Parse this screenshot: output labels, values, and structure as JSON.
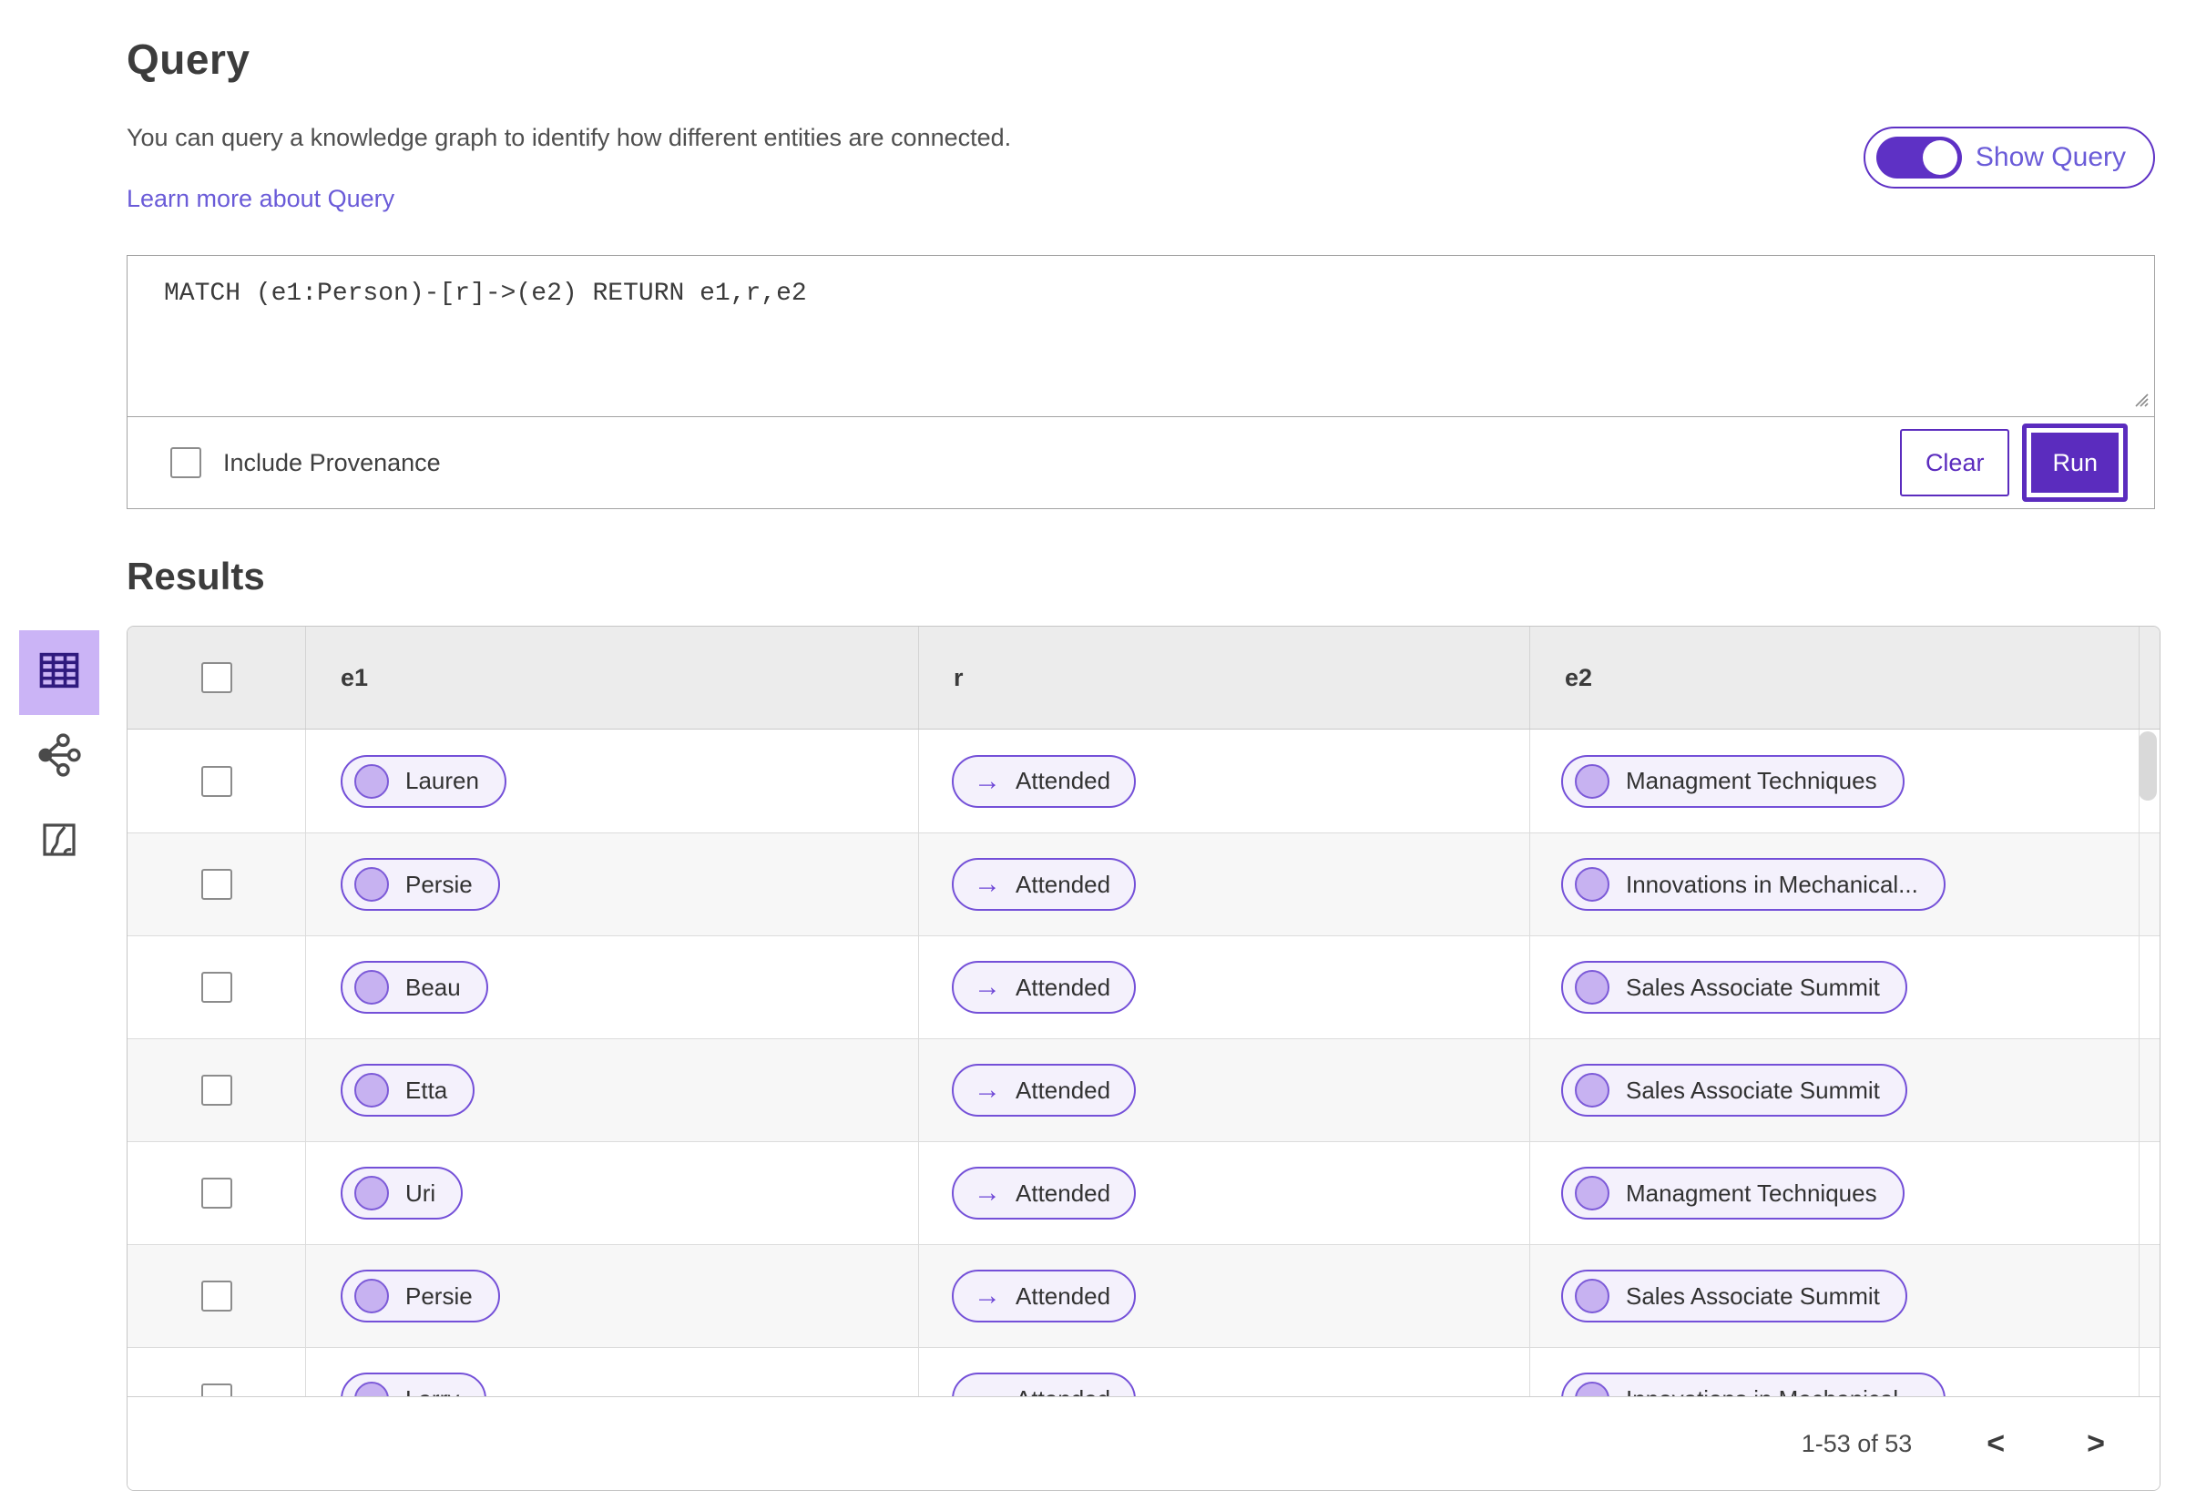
{
  "colors": {
    "accent_deep": "#5b2cbe",
    "accent_link": "#6a5bd8",
    "pill_border": "#7450d8",
    "pill_bg": "#f4f1fc",
    "dot_fill": "#c7b2f1",
    "rail_selected_bg": "#cbb4f6",
    "rail_icon_selected": "#2f1a7e",
    "header_bg": "#ececec",
    "row_stripe": "#f7f7f7"
  },
  "query_section": {
    "title": "Query",
    "description": "You can query a knowledge graph to identify how different entities are connected.",
    "link_label": "Learn more about Query",
    "toggle_label": "Show Query",
    "toggle_state": "on",
    "query_text": "MATCH (e1:Person)-[r]->(e2) RETURN e1,r,e2",
    "include_provenance_label": "Include Provenance",
    "include_provenance_checked": false,
    "clear_label": "Clear",
    "run_label": "Run"
  },
  "results_section": {
    "title": "Results",
    "columns": [
      "e1",
      "r",
      "e2"
    ],
    "rows": [
      {
        "e1": "Lauren",
        "r": "Attended",
        "e2": "Managment Techniques"
      },
      {
        "e1": "Persie",
        "r": "Attended",
        "e2": "Innovations in Mechanical..."
      },
      {
        "e1": "Beau",
        "r": "Attended",
        "e2": "Sales Associate Summit"
      },
      {
        "e1": "Etta",
        "r": "Attended",
        "e2": "Sales Associate Summit"
      },
      {
        "e1": "Uri",
        "r": "Attended",
        "e2": "Managment Techniques"
      },
      {
        "e1": "Persie",
        "r": "Attended",
        "e2": "Sales Associate Summit"
      },
      {
        "e1": "Larry",
        "r": "Attended",
        "e2": "Innovations in Mechanical..."
      }
    ],
    "pagination": {
      "label": "1-53 of 53"
    }
  },
  "icons": {
    "arrow_right": "→",
    "chevron_left": "‹",
    "chevron_right": "›",
    "rail": [
      "table-view-icon",
      "graph-view-icon",
      "chart-view-icon"
    ]
  }
}
